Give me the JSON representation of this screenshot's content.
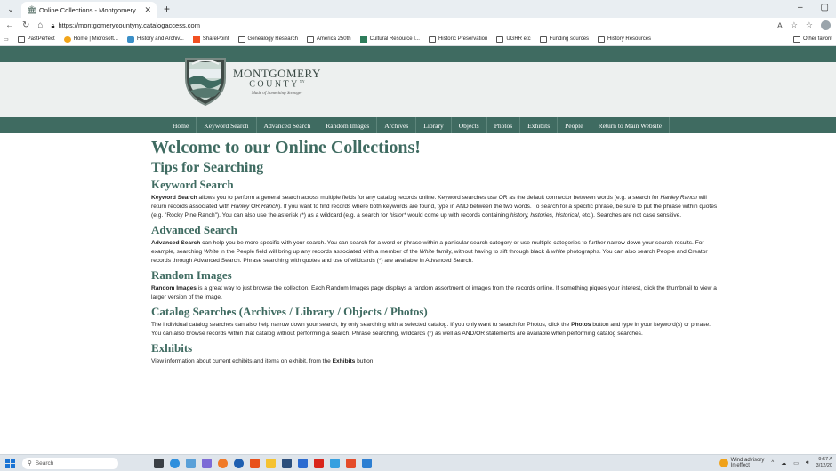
{
  "browser": {
    "tab_title": "Online Collections - Montgomery",
    "url": "https://montgomerycountyny.catalogaccess.com",
    "favorites": [
      "PastPerfect",
      "Home | Microsoft...",
      "History and Archiv...",
      "SharePoint",
      "Genealogy Research",
      "America 250th",
      "Cultural Resource I...",
      "Historic Preservation",
      "UGRR etc",
      "Funding sources",
      "History Resources"
    ],
    "other_favorites": "Other favorit"
  },
  "logo": {
    "line1": "MONTGOMERY",
    "line2": "COUNTY",
    "line2_sup": "NY",
    "tagline": "Made of Something Stronger"
  },
  "menu": [
    "Home",
    "Keyword Search",
    "Advanced Search",
    "Random Images",
    "Archives",
    "Library",
    "Objects",
    "Photos",
    "Exhibits",
    "People",
    "Return to Main Website"
  ],
  "content": {
    "h1": "Welcome to our Online Collections!",
    "h2": "Tips for Searching",
    "kw": {
      "heading": "Keyword Search",
      "lead": "Keyword Search",
      "t1": " allows you to perform a general search across multiple fields for any catalog records online. Keyword searches use OR as the default connector between words (e.g. a search for ",
      "i1": "Hanley Ranch",
      "t2": " will return records associated with ",
      "i2": "Hanley",
      "t3": " OR ",
      "i3": "Ranch",
      "t4": "). If you want to find records where both keywords are found, type in AND between the two words. To search for a specific phrase, be sure to put the phrase within quotes (e.g. \"Rocky Pine Ranch\"). You can also use the asterisk (*) as a wildcard (e.g. a search for ",
      "i4": "histor*",
      "t5": " would come up with records containing ",
      "i5": "history, histories, historical",
      "t6": ", etc.). Searches are not case sensitive."
    },
    "adv": {
      "heading": "Advanced Search",
      "lead": "Advanced Search",
      "t1": " can help you be more specific with your search. You can search for a word or phrase within a particular search category or use multiple categories to further narrow down your search results. For example, searching ",
      "i1": "White",
      "t2": " in the People field will bring up any records associated with a member of the ",
      "i2": "White",
      "t3": " family, without having to sift through black & ",
      "i3": "white",
      "t4": " photographs. You can also search People and Creator records through Advanced Search. Phrase searching with quotes and use of wildcards (*) are available in Advanced Search."
    },
    "rnd": {
      "heading": "Random Images",
      "lead": "Random Images",
      "t1": " is a great way to just browse the collection. Each Random Images page displays a random assortment of images from the records online. If something piques your interest, click the thumbnail to view a larger version of the image."
    },
    "cat": {
      "heading": "Catalog Searches (Archives / Library / Objects / Photos)",
      "t1": "The individual catalog searches can also help narrow down your search, by only searching with a selected catalog. If you only want to search for Photos, click the ",
      "b1": "Photos",
      "t2": " button and type in your keyword(s) or phrase. You can also browse records within that catalog without performing a search. Phrase searching, wildcards (*) as well as AND/OR statements are available when performing catalog searches."
    },
    "exh": {
      "heading": "Exhibits",
      "t1": "View information about current exhibits and items on exhibit, from the ",
      "b1": "Exhibits",
      "t2": " button."
    }
  },
  "taskbar": {
    "search_placeholder": "Search",
    "weather_line1": "Wind advisory",
    "weather_line2": "In effect",
    "weather_badge": "1",
    "time": "9:57 A",
    "date": "3/12/20"
  }
}
